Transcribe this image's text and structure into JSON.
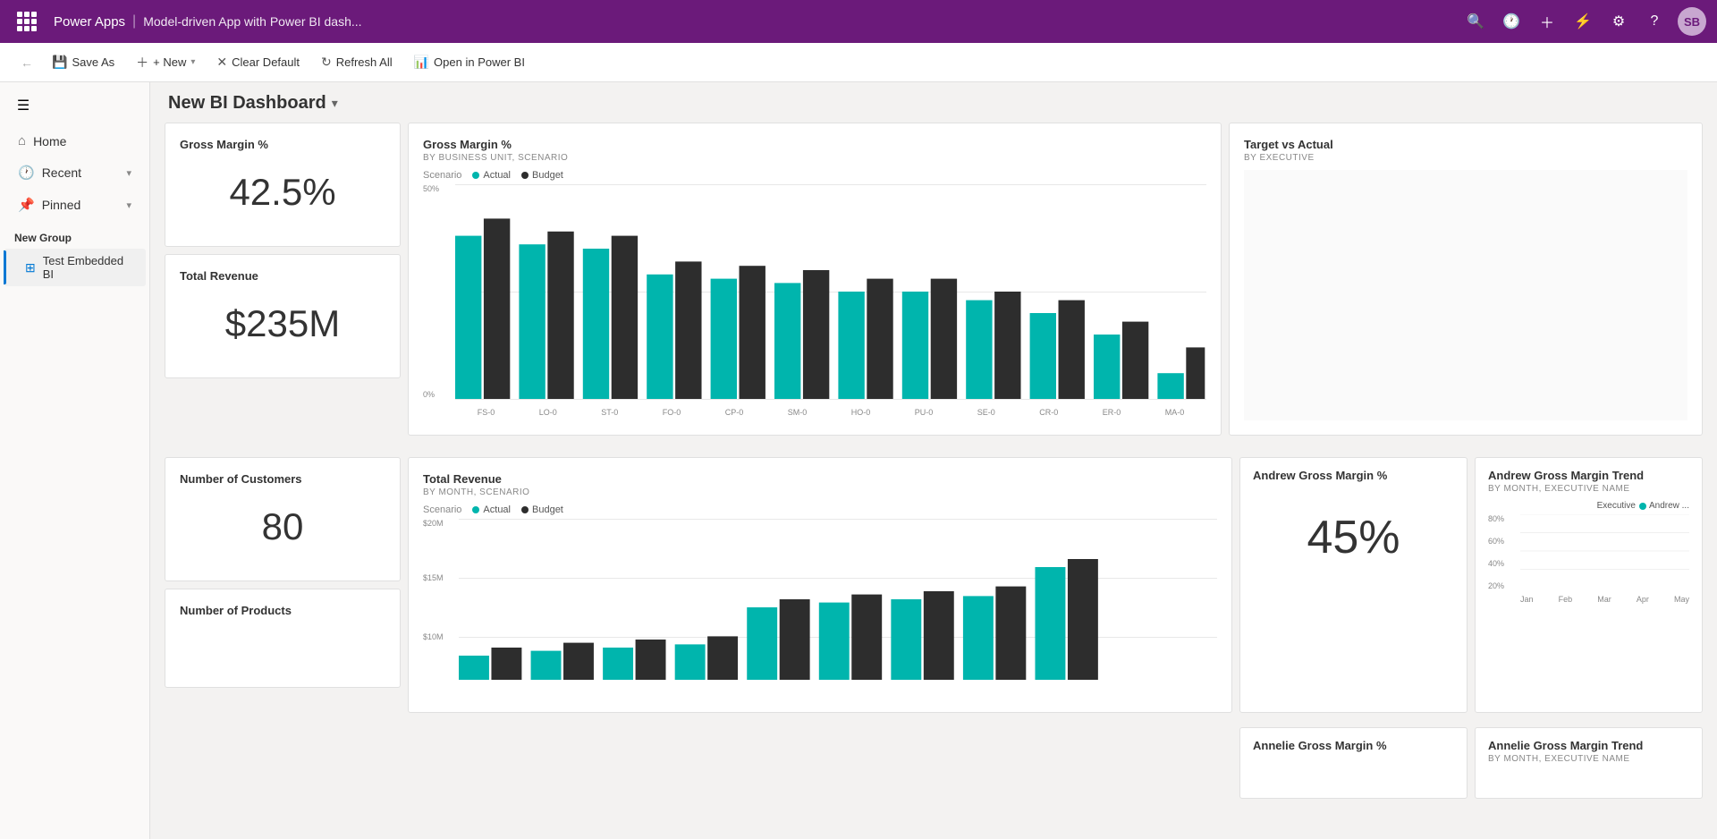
{
  "topbar": {
    "app_name": "Power Apps",
    "separator": "|",
    "page_title": "Model-driven App with Power BI dash...",
    "avatar_text": "SB"
  },
  "toolbar": {
    "back_label": "←",
    "save_as_label": "Save As",
    "new_label": "+ New",
    "clear_default_label": "Clear Default",
    "refresh_all_label": "Refresh All",
    "open_power_bi_label": "Open in Power BI"
  },
  "sidebar": {
    "toggle_icon": "☰",
    "home_label": "Home",
    "recent_label": "Recent",
    "pinned_label": "Pinned",
    "new_group_label": "New Group",
    "nav_item_label": "Test Embedded BI"
  },
  "dashboard": {
    "title": "New BI Dashboard",
    "chevron": "▾"
  },
  "cards": {
    "gross_margin_pct": {
      "title": "Gross Margin %",
      "value": "42.5%"
    },
    "total_revenue": {
      "title": "Total Revenue",
      "value": "$235M"
    },
    "number_of_customers": {
      "title": "Number of Customers",
      "value": "80"
    },
    "number_of_products": {
      "title": "Number of Products",
      "value": ""
    },
    "gross_margin_chart": {
      "title": "Gross Margin %",
      "subtitle": "BY BUSINESS UNIT, SCENARIO",
      "legend_actual": "Actual",
      "legend_budget": "Budget",
      "scenario_label": "Scenario",
      "y_labels": [
        "50%",
        "0%"
      ],
      "x_labels": [
        "FS-0",
        "LO-0",
        "ST-0",
        "FO-0",
        "CP-0",
        "SM-0",
        "HO-0",
        "PU-0",
        "SE-0",
        "CR-0",
        "ER-0",
        "MA-0"
      ]
    },
    "target_vs_actual": {
      "title": "Target vs Actual",
      "subtitle": "BY EXECUTIVE"
    },
    "total_revenue_chart": {
      "title": "Total Revenue",
      "subtitle": "BY MONTH, SCENARIO",
      "legend_actual": "Actual",
      "legend_budget": "Budget",
      "scenario_label": "Scenario",
      "y_labels": [
        "$20M",
        "$15M",
        "$10M"
      ]
    },
    "andrew_gross_margin": {
      "title": "Andrew Gross Margin %",
      "value": "45%"
    },
    "andrew_gross_margin_trend": {
      "title": "Andrew Gross Margin Trend",
      "subtitle": "BY MONTH, EXECUTIVE NAME",
      "legend_executive": "Executive",
      "legend_andrew": "Andrew ...",
      "y_labels": [
        "80%",
        "60%",
        "40%",
        "20%"
      ],
      "x_labels": [
        "Jan",
        "Feb",
        "Mar",
        "Apr",
        "May"
      ]
    },
    "annelie_gross_margin": {
      "title": "Annelie Gross Margin %"
    },
    "annelie_gross_margin_trend": {
      "title": "Annelie Gross Margin Trend",
      "subtitle": "BY MONTH, EXECUTIVE NAME"
    }
  },
  "colors": {
    "purple": "#6b1a7a",
    "teal": "#00b5ad",
    "dark": "#2d2d2d",
    "accent_blue": "#0078d4"
  }
}
